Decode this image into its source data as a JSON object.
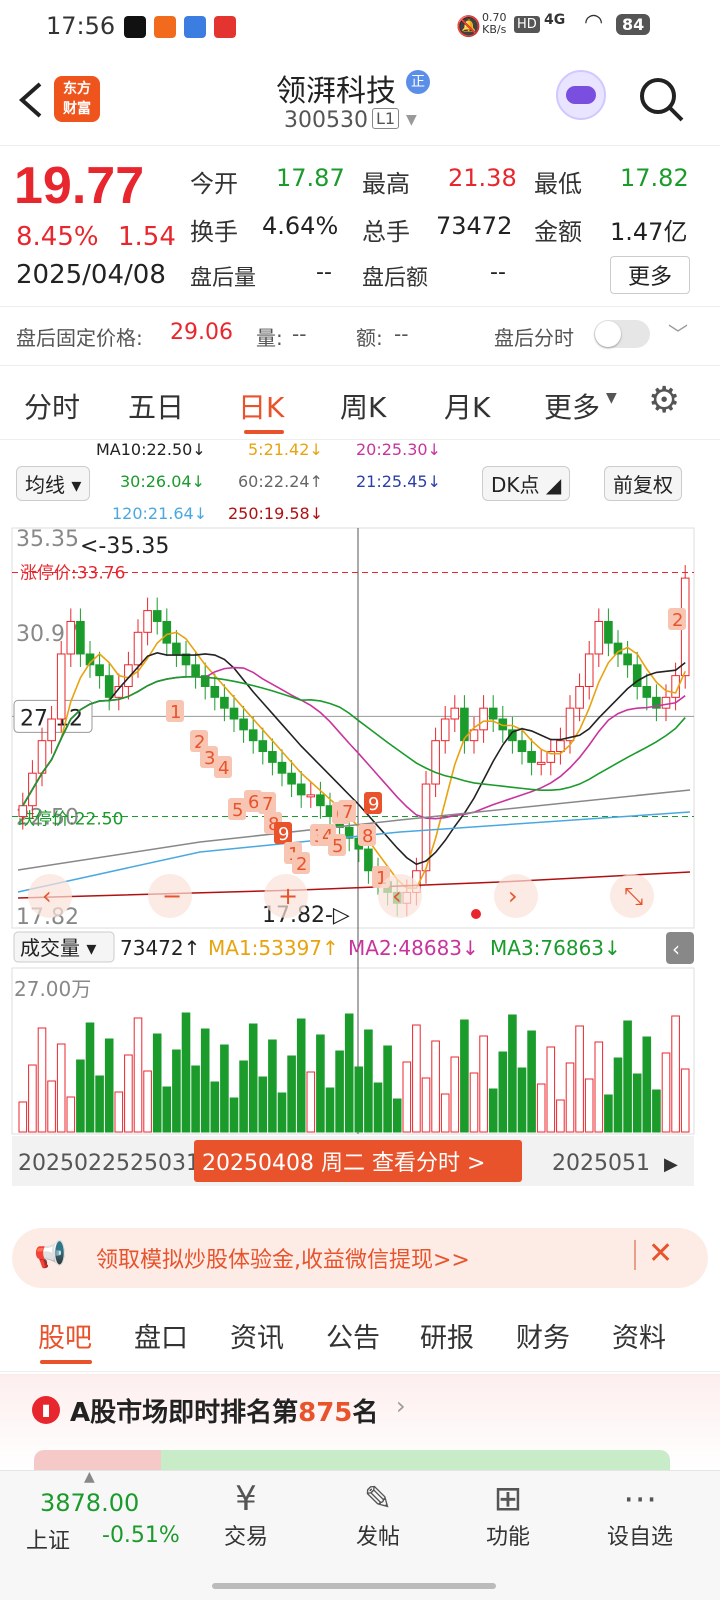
{
  "status": {
    "time": "17:56",
    "net_speed": "0.70",
    "net_unit": "KB/s",
    "hd": "HD",
    "net": "4G",
    "battery": "84"
  },
  "header": {
    "badge_line1": "东方",
    "badge_line2": "财富",
    "stock_name": "领湃科技",
    "stock_code": "300530",
    "level": "L1",
    "name_badge": "正"
  },
  "quote": {
    "price": "19.77",
    "pct": "8.45%",
    "chg": "1.54",
    "date": "2025/04/08",
    "open_label": "今开",
    "open": "17.87",
    "high_label": "最高",
    "high": "21.38",
    "low_label": "最低",
    "low": "17.82",
    "turn_label": "换手",
    "turn": "4.64%",
    "vol_label": "总手",
    "vol": "73472",
    "amt_label": "金额",
    "amt": "1.47亿",
    "ah_vol_label": "盘后量",
    "ah_vol": "--",
    "ah_amt_label": "盘后额",
    "ah_amt": "--",
    "more_btn": "更多",
    "fixed_label": "盘后固定价格:",
    "fixed_price": "29.06",
    "fixed_vol_label": "量:",
    "fixed_vol": "--",
    "fixed_amt_label": "额:",
    "fixed_amt": "--",
    "ah_time_label": "盘后分时"
  },
  "tabs": [
    "分时",
    "五日",
    "日K",
    "周K",
    "月K",
    "更多"
  ],
  "indicators": {
    "ma_btn": "均线",
    "dk_btn": "DK点",
    "fq_btn": "前复权",
    "ma10": "MA10:22.50↓",
    "ma5": "5:21.42↓",
    "ma20": "20:25.30↓",
    "ma30": "30:26.04↓",
    "ma60": "60:22.24↑",
    "ma21": "21:25.45↓",
    "ma120": "120:21.64↓",
    "ma250": "250:19.58↓"
  },
  "chart": {
    "ticks": [
      "35.35",
      "30.97",
      "27.12",
      "22.50",
      "17.82"
    ],
    "max_label": "<-35.35",
    "limit_label": "涨停价:33.76",
    "down_limit_label": "跌停价:22.50",
    "min_label": "17.82-▷",
    "vol_btn": "成交量",
    "vol_value": "73472↑",
    "vol_ma1": "MA1:53397↑",
    "vol_ma2": "MA2:48683↓",
    "vol_ma3": "MA3:76863↓",
    "vol_max": "27.00万",
    "date_left": "20250225",
    "date_mid": "250311",
    "date_right": "2025051",
    "highlight": "20250408 周二 查看分时 >",
    "tds": [
      "1",
      "2",
      "3",
      "4",
      "5",
      "6",
      "7",
      "8",
      "9",
      "1",
      "2",
      "3",
      "4",
      "5",
      "6",
      "7",
      "8",
      "9",
      "1",
      "2"
    ]
  },
  "promo": {
    "text": "领取模拟炒股体验金,收益微信提现>>"
  },
  "subtabs": [
    "股吧",
    "盘口",
    "资讯",
    "公告",
    "研报",
    "财务",
    "资料"
  ],
  "rank": {
    "prefix": "A股市场即时排名第",
    "num": "875",
    "suffix": "名"
  },
  "bottom": {
    "index_value": "3878.00",
    "index_name": "上证",
    "index_pct": "-0.51%",
    "items": [
      "交易",
      "发帖",
      "功能",
      "设自选"
    ]
  },
  "colors": {
    "up": "#e8262d",
    "down": "#1a9b2b",
    "accent": "#e8532c",
    "ma5": "#e8a30f",
    "ma10": "#222222",
    "ma20": "#c8349d",
    "ma30": "#1a9b2b",
    "ma60": "#888888",
    "ma120": "#4aa8e0",
    "ma250": "#b01010"
  }
}
